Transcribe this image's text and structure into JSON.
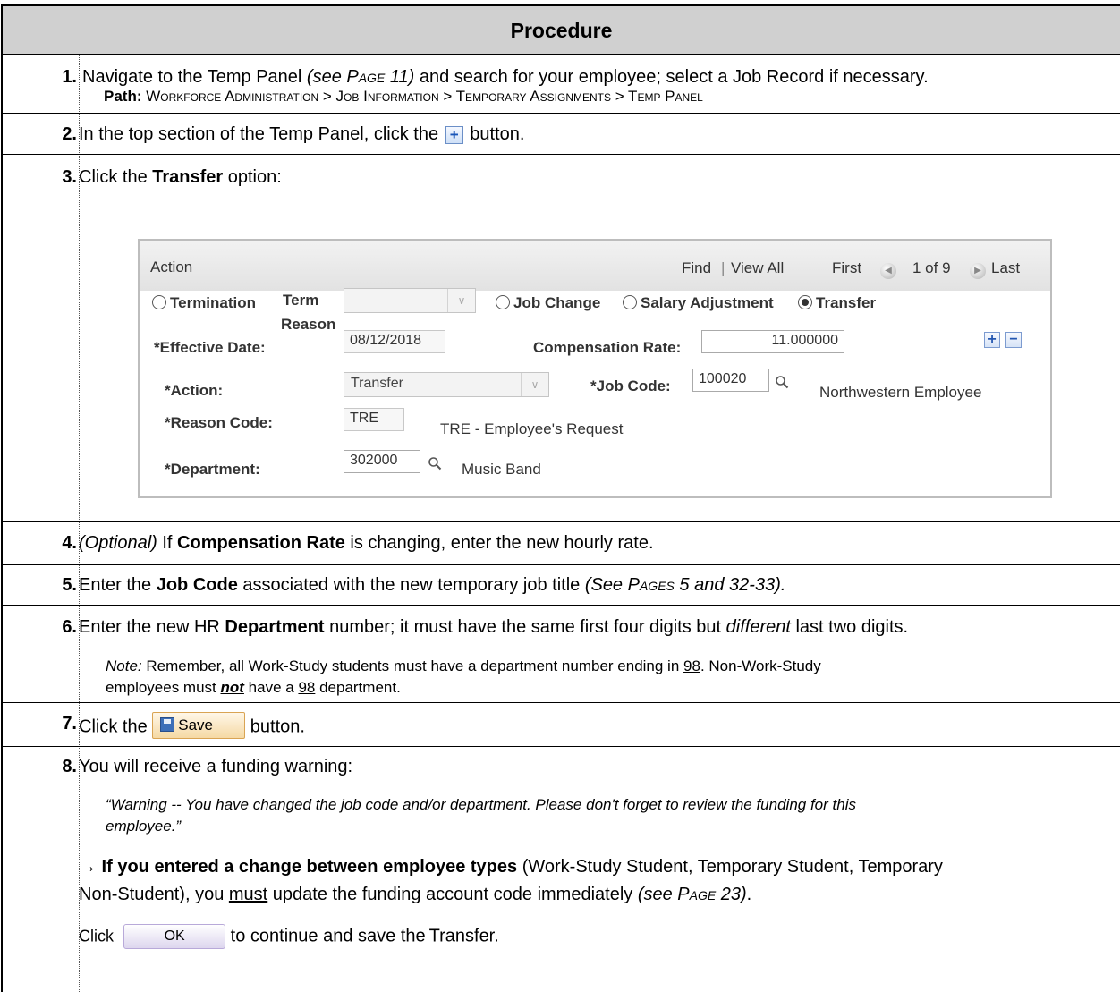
{
  "header": {
    "title": "Procedure"
  },
  "steps": {
    "s1": {
      "num": "1.",
      "text_a": "Navigate to the Temp Panel ",
      "see": "(see ",
      "page_word": "Page",
      "page_ref": " 11)",
      "text_b": " and search for your employee; select a Job Record if necessary.",
      "path_label": "Path:",
      "path": "Workforce Administration > Job Information > Temporary Assignments > Temp Panel"
    },
    "s2": {
      "num": "2.",
      "text_a": "In the top section of the Temp Panel, click the ",
      "plus": "+",
      "text_b": " button."
    },
    "s3": {
      "num": "3.",
      "text_a": "Click the ",
      "bold": "Transfer",
      "text_b": " option:"
    },
    "s4": {
      "num": "4.",
      "opt": "(Optional)",
      "text_a": " If ",
      "bold": "Compensation Rate",
      "text_b": " is changing, enter the new hourly rate."
    },
    "s5": {
      "num": "5.",
      "text_a": "Enter the ",
      "bold": "Job Code",
      "text_b": " associated with the new temporary job title ",
      "see": "(See ",
      "pages_word": "Pages",
      "pages_ref": " 5 and 32-33)."
    },
    "s6": {
      "num": "6.",
      "text_a": "Enter the new HR ",
      "bold": "Department",
      "text_b": " number; it must have the same first four digits but ",
      "ital": "different",
      "text_c": " last two digits.",
      "note_label": "Note:",
      "note_a": " Remember, all Work-Study students must have a department number ending in ",
      "n98": "98",
      "note_b": ". Non-Work-Study",
      "note2_a": "employees must ",
      "not": "not",
      "note2_b": " have a ",
      "n98b": "98",
      "note2_c": " department."
    },
    "s7": {
      "num": "7.",
      "text_a": "Click the ",
      "save": "Save",
      "text_b": " button."
    },
    "s8": {
      "num": "8.",
      "text_a": "You will receive a funding warning:",
      "quote1": "“Warning -- You have changed the job code and/or department. Please don't forget to review the funding for this",
      "quote2": "employee.”",
      "arrow": "→",
      "bold": " If you entered a change between employee types",
      "text_b": " (Work-Study Student, Temporary Student, Temporary",
      "text_c": "Non-Student), you ",
      "must": "must",
      "text_d": " update the funding account code immediately ",
      "see": "(see ",
      "page_word": "Page",
      "page_ref": " 23)",
      "dot": ".",
      "click": "Click",
      "ok": "OK",
      "tail": " to continue and save the Transfer."
    }
  },
  "panel": {
    "title": "Action",
    "find": "Find",
    "sep": "|",
    "view_all": "View All",
    "first": "First",
    "count": "1 of 9",
    "last": "Last",
    "radios": {
      "termination": "Termination",
      "term_reason_1": "Term",
      "term_reason_2": "Reason",
      "job_change": "Job Change",
      "salary_adjustment": "Salary Adjustment",
      "transfer": "Transfer",
      "selected": "transfer"
    },
    "effective_date_label": "*Effective Date:",
    "effective_date": "08/12/2018",
    "comp_rate_label": "Compensation Rate:",
    "comp_rate": "11.000000",
    "action_label": "*Action:",
    "action": "Transfer",
    "job_code_label": "*Job Code:",
    "job_code": "100020",
    "job_desc": "Northwestern Employee",
    "reason_label": "*Reason Code:",
    "reason": "TRE",
    "reason_desc": "TRE - Employee's Request",
    "dept_label": "*Department:",
    "dept": "302000",
    "dept_desc": "Music Band",
    "add": "+",
    "remove": "−"
  }
}
